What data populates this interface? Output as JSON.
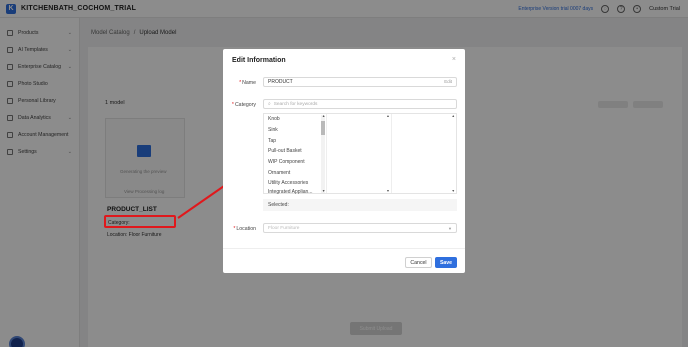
{
  "app": {
    "logo_letter": "K",
    "title": "KITCHENBATH_COCHOM_TRIAL",
    "trial_link": "Enterprise Version trial 0007 days",
    "user_name": "Custom Trial",
    "accent_color": "#2f6fde"
  },
  "sidebar": {
    "items": [
      {
        "label": "Products",
        "icon": "box-icon",
        "has_chevron": true
      },
      {
        "label": "AI Templates",
        "icon": "template-icon",
        "has_chevron": true
      },
      {
        "label": "Enterprise Catalog",
        "icon": "catalog-icon",
        "has_chevron": true
      },
      {
        "label": "Photo Studio",
        "icon": "camera-icon",
        "has_chevron": false
      },
      {
        "label": "Personal Library",
        "icon": "library-icon",
        "has_chevron": false
      },
      {
        "label": "Data Analytics",
        "icon": "chart-icon",
        "has_chevron": true
      },
      {
        "label": "Account Management",
        "icon": "user-icon",
        "has_chevron": false
      },
      {
        "label": "Settings",
        "icon": "gear-icon",
        "has_chevron": true
      }
    ]
  },
  "breadcrumb": {
    "parent": "Model Catalog",
    "separator": "/",
    "current": "Upload Model"
  },
  "background": {
    "toolbar_label": "1 model",
    "card_line1": "Generating the preview",
    "card_line2": "View Processing log",
    "product_list": "PRODUCT_LIST",
    "category_row": "Category: ",
    "location_row": "Location: Floor Furniture",
    "submit_button": "Submit Upload"
  },
  "modal": {
    "title": "Edit Information",
    "close_glyph": "×",
    "name": {
      "label": "Name",
      "value": "PRODUCT",
      "edit_label": "Edit"
    },
    "category": {
      "label": "Category",
      "search_placeholder": "Search for keywords",
      "options": [
        "Knob",
        "Sink",
        "Tap",
        "Pull-out Basket",
        "WIP Component",
        "Ornament",
        "Utility Accessories",
        "Integrated Applian..."
      ],
      "selected_label": "Selected:"
    },
    "location": {
      "label": "Location",
      "placeholder": "Floor Furniture"
    },
    "cancel_label": "Cancel",
    "save_label": "Save"
  },
  "annotation": {
    "color": "#e0181c"
  }
}
